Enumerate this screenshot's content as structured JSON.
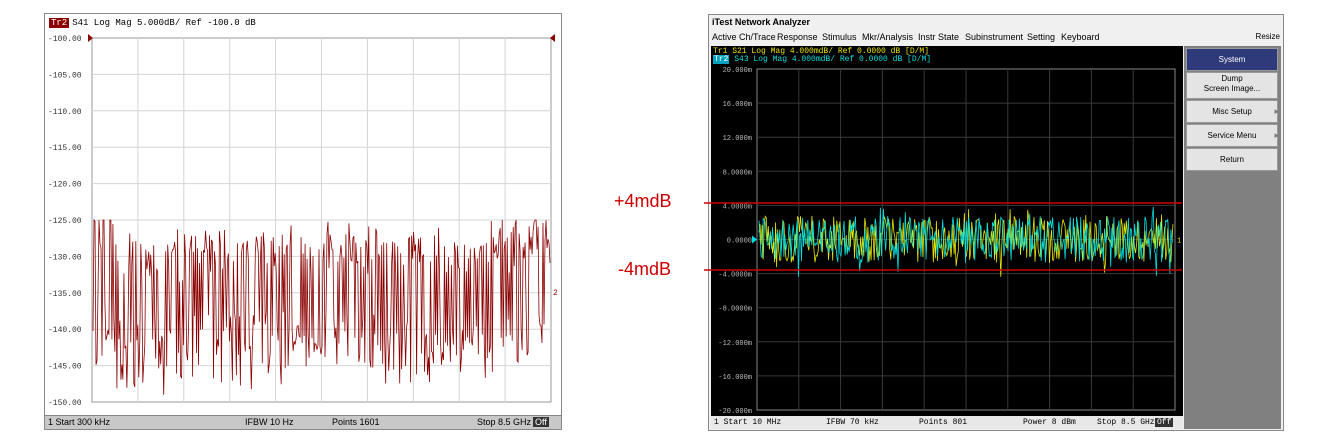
{
  "left": {
    "badge": "Tr2",
    "title": "S41 Log Mag 5.000dB/ Ref -100.0 dB",
    "y_ticks": [
      "-100.00",
      "-105.00",
      "-110.00",
      "-115.00",
      "-120.00",
      "-125.00",
      "-130.00",
      "-135.00",
      "-140.00",
      "-145.00",
      "-150.00"
    ],
    "trace_marker": "2",
    "footer": {
      "start": "1 Start 300 kHz",
      "ifbw": "IFBW 10 Hz",
      "points": "Points 1601",
      "stop": "Stop 8.5 GHz",
      "off": "Off"
    },
    "trace_color": "#8b0000"
  },
  "right": {
    "app_title": "iTest Network Analyzer",
    "menu": [
      "Active Ch/Trace",
      "Response",
      "Stimulus",
      "Mkr/Analysis",
      "Instr State",
      "Subinstrument",
      "Setting",
      "Keyboard"
    ],
    "resize": "Resize",
    "header": {
      "tr1": "Tr1 S21 Log Mag 4.000mdB/ Ref  0.0000 dB [D/M]",
      "tr2_badge": "Tr2",
      "tr2": "S43 Log Mag 4.000mdB/ Ref  0.0000 dB [D/M]"
    },
    "y_ticks": [
      "20.000m",
      "16.000m",
      "12.000m",
      "8.0000m",
      "4.0000m",
      "0.0000",
      "-4.0000m",
      "-8.0000m",
      "-12.000m",
      "-16.000m",
      "-20.000m"
    ],
    "trace_marker": "1",
    "footer": {
      "start": "1 Start 10 MHz",
      "ifbw": "IFBW 70 kHz",
      "points": "Points 801",
      "power": "Power 8 dBm",
      "stop": "Stop 8.5 GHz",
      "off": "Off"
    },
    "softkeys": {
      "system": "System",
      "dump_line1": "Dump",
      "dump_line2": "Screen Image...",
      "misc": "Misc Setup",
      "service": "Service Menu",
      "return": "Return"
    },
    "trace1_color": "#e6e600",
    "trace2_color": "#00e0e0"
  },
  "annotations": {
    "upper": "+4mdB",
    "lower": "-4mdB",
    "color": "#cc0000"
  }
}
